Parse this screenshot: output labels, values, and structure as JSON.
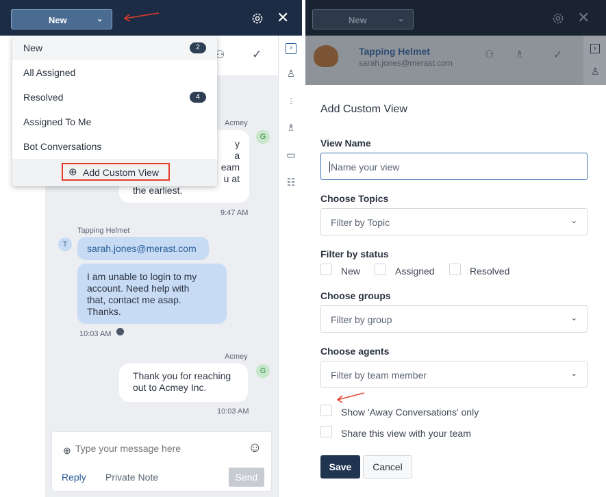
{
  "left": {
    "view_button": "New",
    "menu": [
      {
        "label": "New",
        "count": "2"
      },
      {
        "label": "All Assigned",
        "count": ""
      },
      {
        "label": "Resolved",
        "count": "4"
      },
      {
        "label": "Assigned To Me",
        "count": ""
      },
      {
        "label": "Bot Conversations",
        "count": ""
      }
    ],
    "add_custom_view": "Add Custom View",
    "chat": {
      "agent_name_1": "Acmey",
      "partial_lines": [
        "y",
        "a",
        "eam",
        "u at",
        "the earliest."
      ],
      "time_1": "9:47 AM",
      "customer_name": "Tapping Helmet",
      "customer_avatar": "T",
      "customer_email": "sarah.jones@merast.com",
      "customer_msg": [
        "I am unable to login to my",
        "account. Need help with",
        "that, contact me asap.",
        "Thanks."
      ],
      "time_2": "10:03 AM",
      "agent_name_2": "Acmey",
      "agent_avatar": "G",
      "reply_msg": [
        "Thank you for reaching",
        "out to Acmey Inc."
      ],
      "time_3": "10:03 AM"
    },
    "composer": {
      "placeholder": "Type your message here",
      "tab_reply": "Reply",
      "tab_private": "Private Note",
      "send": "Send"
    }
  },
  "right": {
    "view_button": "New",
    "contact_name": "Tapping Helmet",
    "contact_email": "sarah.jones@merast.com",
    "modal": {
      "title": "Add Custom View",
      "view_name_label": "View Name",
      "view_name_placeholder": "Name your view",
      "topics_label": "Choose Topics",
      "topics_placeholder": "Filter by Topic",
      "status_label": "Filter by status",
      "status_options": [
        "New",
        "Assigned",
        "Resolved"
      ],
      "groups_label": "Choose groups",
      "groups_placeholder": "Filter by group",
      "agents_label": "Choose agents",
      "agents_placeholder": "Filter by team member",
      "away_only": "Show 'Away Conversations' only",
      "share_view": "Share this view with your team",
      "save": "Save",
      "cancel": "Cancel"
    }
  },
  "colors": {
    "topbar": "#1c2c44",
    "accent": "#1f3550",
    "highlight": "#e53d2a",
    "bubble_in": "#c7dbf4"
  }
}
